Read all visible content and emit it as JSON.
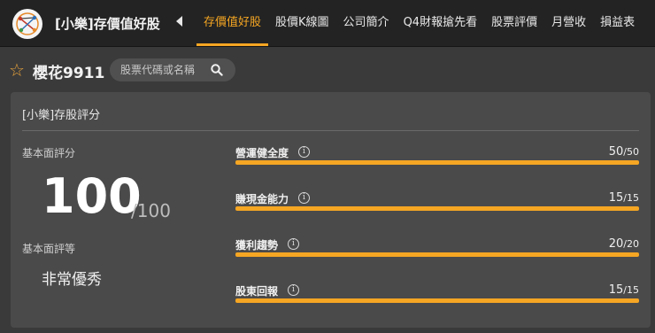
{
  "header": {
    "app_title": "[小樂]存價值好股",
    "tabs": [
      {
        "label": "存價值好股",
        "active": true
      },
      {
        "label": "股價K線圖",
        "active": false
      },
      {
        "label": "公司簡介",
        "active": false
      },
      {
        "label": "Q4財報搶先看",
        "active": false
      },
      {
        "label": "股票評價",
        "active": false
      },
      {
        "label": "月營收",
        "active": false
      },
      {
        "label": "損益表",
        "active": false
      }
    ]
  },
  "stock": {
    "name": "櫻花9911",
    "search_placeholder": "股票代碼或名稱"
  },
  "card": {
    "title": "[小樂]存股評分",
    "score_label": "基本面評分",
    "score": "100",
    "score_max": "/100",
    "grade_label": "基本面評等",
    "grade": "非常優秀",
    "metrics": [
      {
        "name": "營運健全度",
        "value": "50",
        "max": "/50",
        "fraction": 1.0
      },
      {
        "name": "賺現金能力",
        "value": "15",
        "max": "/15",
        "fraction": 1.0
      },
      {
        "name": "獲利趨勢",
        "value": "20",
        "max": "/20",
        "fraction": 1.0
      },
      {
        "name": "股東回報",
        "value": "15",
        "max": "/15",
        "fraction": 1.0
      }
    ]
  },
  "colors": {
    "accent": "#f5a623",
    "star": "#e6a23c"
  },
  "icons": {
    "star": "star-icon",
    "search": "search-icon",
    "info": "info-icon",
    "back": "chevron-left-icon"
  }
}
